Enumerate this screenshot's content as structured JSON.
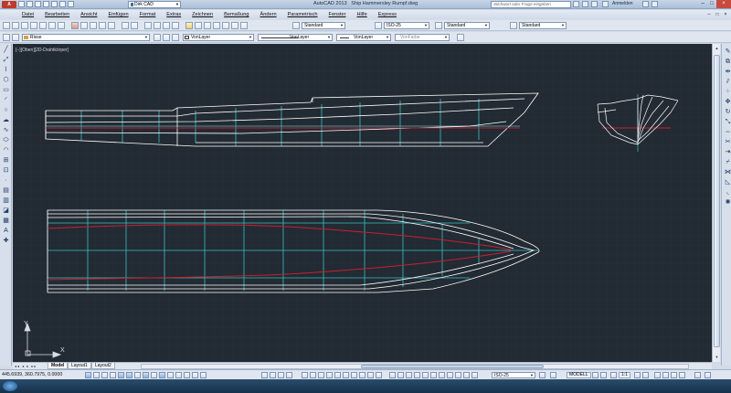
{
  "window": {
    "title": "AutoCAD 2013",
    "document": "Ship Hammersley Rumpf.dwg",
    "workspace": "Dirk CAD",
    "search_placeholder": "Stichwort oder Frage eingeben",
    "login_label": "Anmelden",
    "app_logo": "A",
    "window_buttons": [
      "–",
      "□",
      "×"
    ],
    "doc_buttons": [
      "–",
      "□",
      "×"
    ]
  },
  "menu": [
    "Datei",
    "Bearbeiten",
    "Ansicht",
    "Einfügen",
    "Format",
    "Extras",
    "Zeichnen",
    "Bemaßung",
    "Ändern",
    "Parametrisch",
    "Fenster",
    "Hilfe",
    "Express"
  ],
  "toolbar1": {
    "text_style": "Standard",
    "dim_style": "ISO-25",
    "table_style": "Standard",
    "multileader_style": "Standard"
  },
  "toolbar2": {
    "layer": "Risse",
    "color": "VonLayer",
    "linetype": "VonLayer",
    "lineweight": "VonLayer",
    "plotstyle": "VonFarbe"
  },
  "viewport": {
    "label": "[−][Oben][2D-Drahtkörper]",
    "ucs_y": "Y",
    "ucs_x": "X"
  },
  "tabs": [
    {
      "label": "Model",
      "active": true
    },
    {
      "label": "Layout1",
      "active": false
    },
    {
      "label": "Layout2",
      "active": false
    }
  ],
  "tab_nav": "◂◂ ◂ ▸ ▸▸",
  "status": {
    "coordinates": "445.6939, 360.7975, 0.0000",
    "annotation_scale": "1:1",
    "dim_style": "ISO-25",
    "mode": "MODELL"
  },
  "colors": {
    "background": "#222a33",
    "hull_lines": "#ffffff",
    "station_lines": "#35c3c3",
    "waterline_red": "#c8202e",
    "grid": "#2a323c"
  }
}
